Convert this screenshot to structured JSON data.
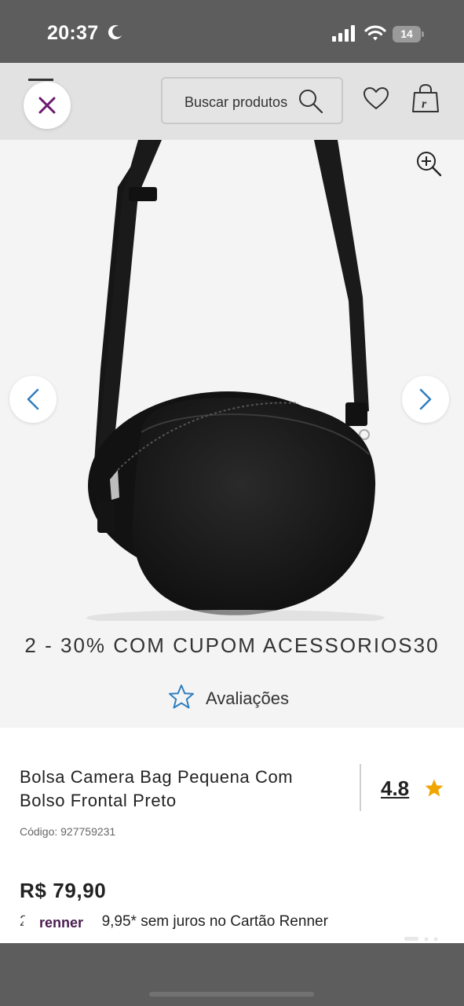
{
  "status_bar": {
    "time": "20:37",
    "battery": "14",
    "icons": [
      "moon-icon",
      "signal-icon",
      "wifi-icon",
      "battery-icon"
    ]
  },
  "header": {
    "search_placeholder": "Buscar produtos",
    "icons": [
      "close-icon",
      "search-icon",
      "heart-icon",
      "shopping-bag-icon"
    ],
    "accent_color": "#6b1a6f"
  },
  "gallery": {
    "icons": [
      "zoom-in-icon",
      "chevron-left-icon",
      "chevron-right-icon"
    ],
    "arrow_color": "#2f7fc1"
  },
  "promo": {
    "text": "2 - 30% COM CUPOM ACESSORIOS30"
  },
  "reviews": {
    "label": "Avaliações",
    "star_color": "#2f7fc1"
  },
  "product": {
    "title": "Bolsa Camera Bag Pequena Com Bolso Frontal Preto",
    "rating": "4.8",
    "rating_star_color": "#f0a500",
    "code": "Código: 927759231",
    "price": "R$ 79,90",
    "installments_prefix": "2",
    "installments_suffix": "9,95* sem juros no Cartão Renner"
  },
  "brand": {
    "label": "renner",
    "color": "#4a1d4f"
  }
}
